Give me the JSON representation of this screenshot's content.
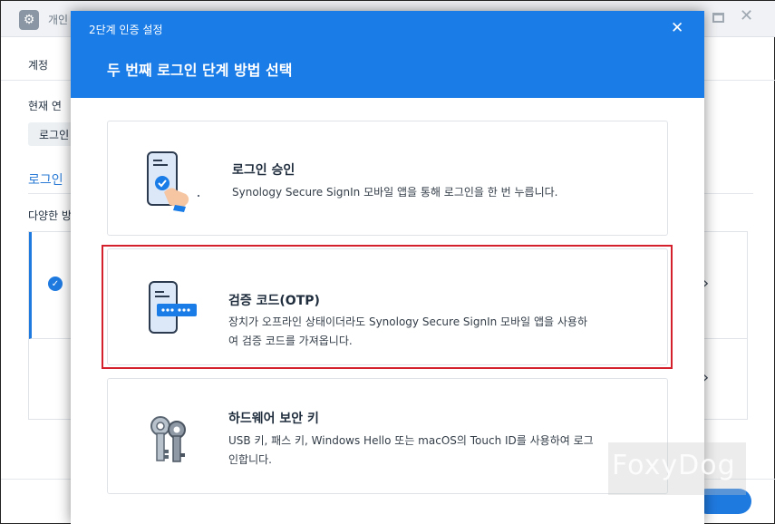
{
  "background": {
    "window_title": "개인",
    "tab_label": "계정",
    "current_label": "현재 연",
    "chip_label": "로그인",
    "section_title": "로그인",
    "section_desc": "다양한 방"
  },
  "modal": {
    "title": "2단계 인증 설정",
    "heading": "두 번째 로그인 단계 방법 선택",
    "options": [
      {
        "title": "로그인 승인",
        "desc_line1": "Synology Secure SignIn 모바일 앱을 통해 로그인을 한 번 누릅니다.",
        "desc_line2": ""
      },
      {
        "title": "검증 코드(OTP)",
        "desc_line1": "장치가 오프라인 상태이더라도 Synology Secure SignIn 모바일 앱을 사용하",
        "desc_line2": "여 검증 코드를 가져옵니다."
      },
      {
        "title": "하드웨어 보안 키",
        "desc_line1": "USB 키, 패스 키, Windows Hello 또는 macOS의 Touch ID를 사용하여 로그",
        "desc_line2": "인합니다."
      }
    ]
  },
  "watermark": "FoxyDog",
  "colors": {
    "header_blue": "#1a7ce6",
    "highlight_red": "#d4202c"
  },
  "icons": {
    "close": "close-icon",
    "phone_tap": "phone-tap-icon",
    "phone_otp": "phone-otp-icon",
    "keys": "keys-icon"
  }
}
